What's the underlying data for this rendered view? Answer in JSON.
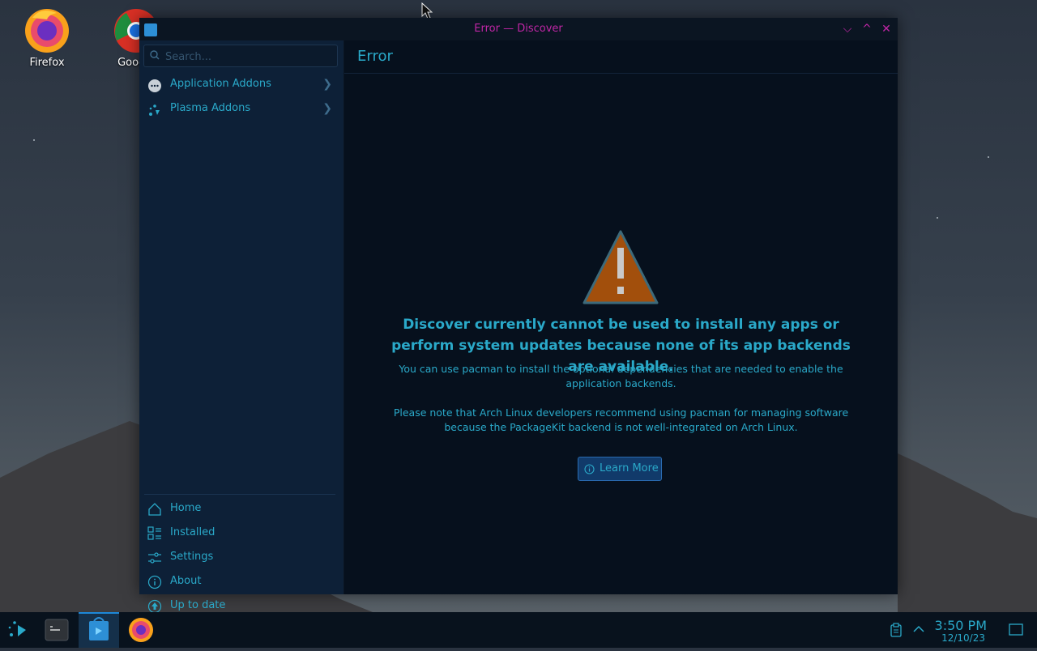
{
  "desktop": {
    "icons": [
      {
        "label": "Firefox"
      },
      {
        "label": "Google"
      }
    ]
  },
  "window": {
    "title": "Error — Discover"
  },
  "sidebar": {
    "search_placeholder": "Search...",
    "categories": [
      {
        "label": "Application Addons"
      },
      {
        "label": "Plasma Addons"
      }
    ],
    "nav": [
      {
        "label": "Home"
      },
      {
        "label": "Installed"
      },
      {
        "label": "Settings"
      },
      {
        "label": "About"
      },
      {
        "label": "Up to date"
      }
    ]
  },
  "main": {
    "header": "Error",
    "headline": "Discover currently cannot be used to install any apps or perform system updates because none of its app backends are available.",
    "para1": "You can use pacman to install the optional dependencies that are needed to enable the application backends.",
    "para2": "Please note that Arch Linux developers recommend using pacman for managing software because the PackageKit backend is not well-integrated on Arch Linux.",
    "button_label": "Learn More"
  },
  "taskbar": {
    "time": "3:50 PM",
    "date": "12/10/23"
  },
  "colors": {
    "accent": "#2aa9c9",
    "title_text": "#c026a6",
    "button_bg": "#113a6a",
    "warning": "#a24f0c"
  }
}
